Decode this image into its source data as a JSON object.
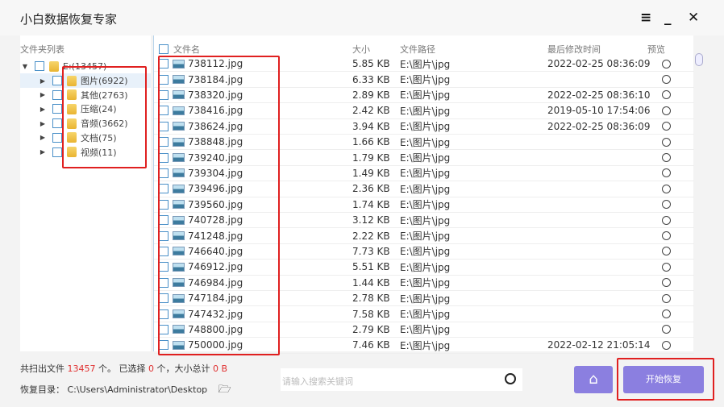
{
  "title": "小白数据恢复专家",
  "left": {
    "header": "文件夹列表",
    "root": "E:(13457)",
    "folders": [
      "图片(6922)",
      "其他(2763)",
      "压缩(24)",
      "音频(3662)",
      "文档(75)",
      "视频(11)"
    ]
  },
  "columns": {
    "name": "文件名",
    "size": "大小",
    "path": "文件路径",
    "modified": "最后修改时间",
    "preview": "预览"
  },
  "files": [
    {
      "name": "738112.jpg",
      "size": "5.85 KB",
      "path": "E:\\图片\\jpg",
      "modified": "2022-02-25 08:36:09"
    },
    {
      "name": "738184.jpg",
      "size": "6.33 KB",
      "path": "E:\\图片\\jpg",
      "modified": ""
    },
    {
      "name": "738320.jpg",
      "size": "2.89 KB",
      "path": "E:\\图片\\jpg",
      "modified": "2022-02-25 08:36:10"
    },
    {
      "name": "738416.jpg",
      "size": "2.42 KB",
      "path": "E:\\图片\\jpg",
      "modified": "2019-05-10 17:54:06"
    },
    {
      "name": "738624.jpg",
      "size": "3.94 KB",
      "path": "E:\\图片\\jpg",
      "modified": "2022-02-25 08:36:09"
    },
    {
      "name": "738848.jpg",
      "size": "1.66 KB",
      "path": "E:\\图片\\jpg",
      "modified": ""
    },
    {
      "name": "739240.jpg",
      "size": "1.79 KB",
      "path": "E:\\图片\\jpg",
      "modified": ""
    },
    {
      "name": "739304.jpg",
      "size": "1.49 KB",
      "path": "E:\\图片\\jpg",
      "modified": ""
    },
    {
      "name": "739496.jpg",
      "size": "2.36 KB",
      "path": "E:\\图片\\jpg",
      "modified": ""
    },
    {
      "name": "739560.jpg",
      "size": "1.74 KB",
      "path": "E:\\图片\\jpg",
      "modified": ""
    },
    {
      "name": "740728.jpg",
      "size": "3.12 KB",
      "path": "E:\\图片\\jpg",
      "modified": ""
    },
    {
      "name": "741248.jpg",
      "size": "2.22 KB",
      "path": "E:\\图片\\jpg",
      "modified": ""
    },
    {
      "name": "746640.jpg",
      "size": "7.73 KB",
      "path": "E:\\图片\\jpg",
      "modified": ""
    },
    {
      "name": "746912.jpg",
      "size": "5.51 KB",
      "path": "E:\\图片\\jpg",
      "modified": ""
    },
    {
      "name": "746984.jpg",
      "size": "1.44 KB",
      "path": "E:\\图片\\jpg",
      "modified": ""
    },
    {
      "name": "747184.jpg",
      "size": "2.78 KB",
      "path": "E:\\图片\\jpg",
      "modified": ""
    },
    {
      "name": "747432.jpg",
      "size": "7.58 KB",
      "path": "E:\\图片\\jpg",
      "modified": ""
    },
    {
      "name": "748800.jpg",
      "size": "2.79 KB",
      "path": "E:\\图片\\jpg",
      "modified": ""
    },
    {
      "name": "750000.jpg",
      "size": "7.46 KB",
      "path": "E:\\图片\\jpg",
      "modified": "2022-02-12 21:05:14"
    }
  ],
  "status": {
    "p1": "共扫出文件 ",
    "total": "13457",
    "p2": " 个。 已选择 ",
    "selected": "0",
    "p3": " 个，大小总计 ",
    "size": "0 B"
  },
  "restore_dir": {
    "label": "恢复目录：",
    "path": "C:\\Users\\Administrator\\Desktop"
  },
  "search": {
    "placeholder": "请输入搜索关键词"
  },
  "start_button": "开始恢复"
}
